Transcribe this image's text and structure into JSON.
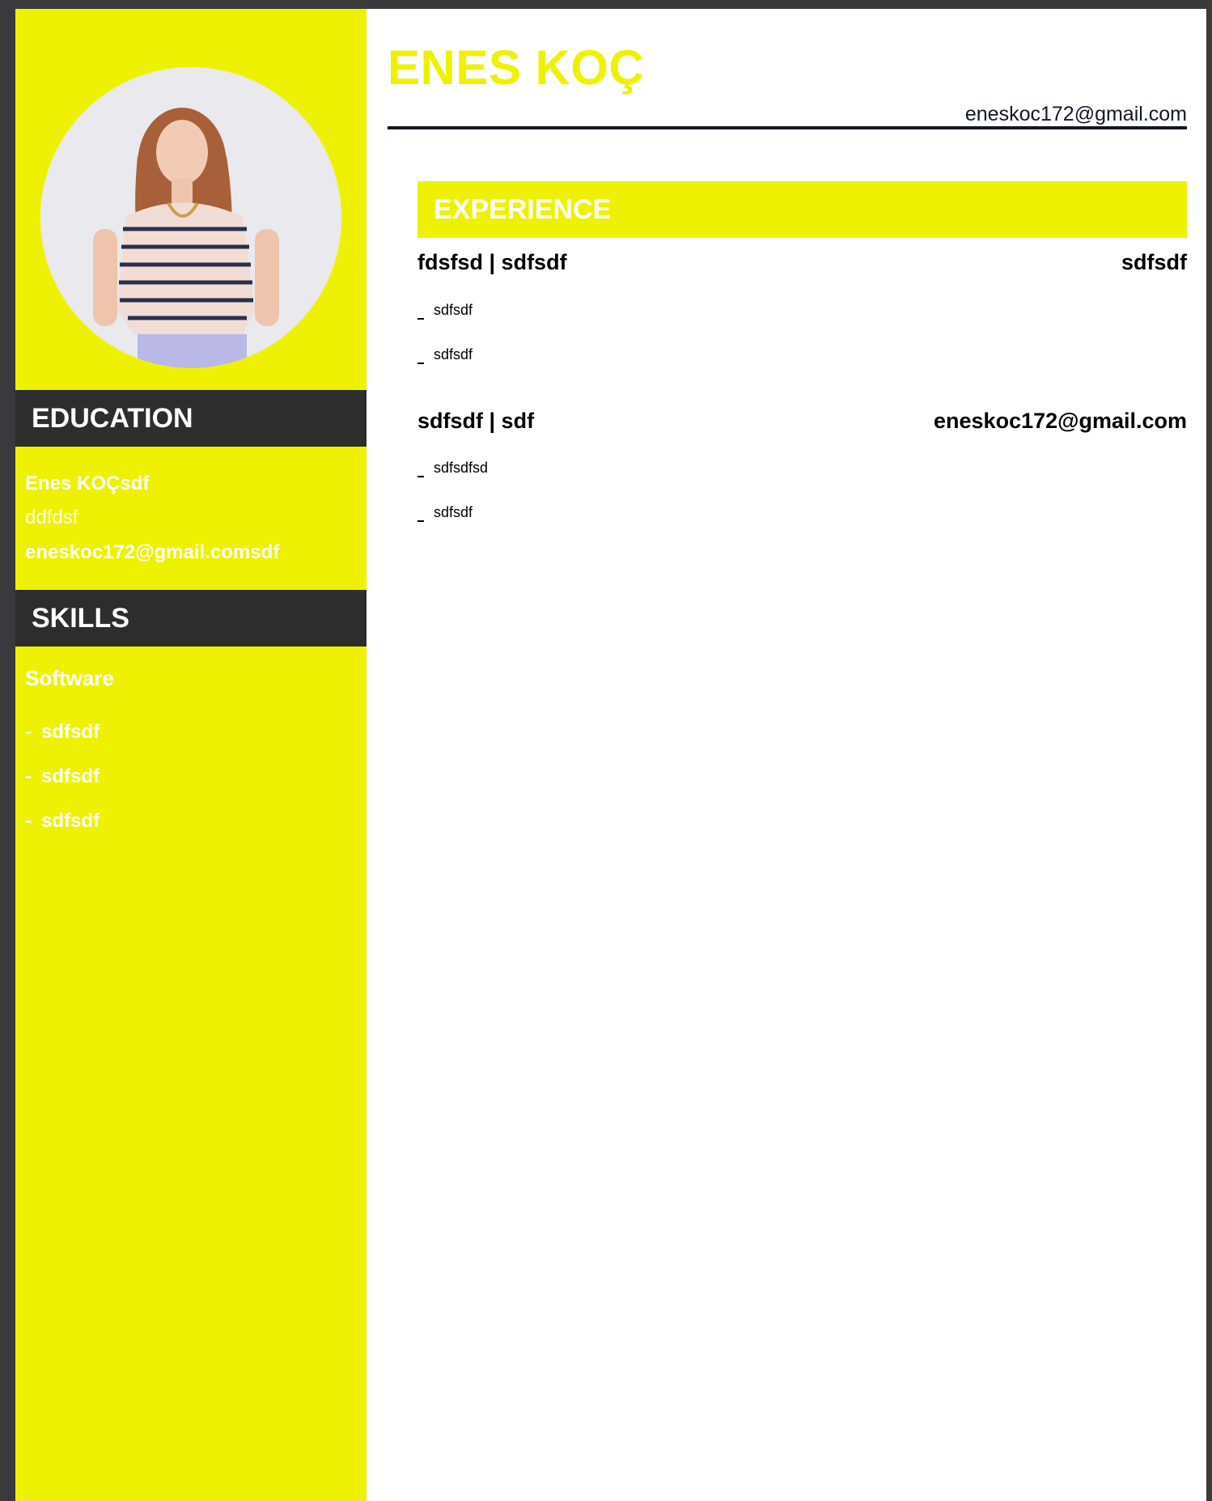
{
  "header": {
    "name": "ENES KOÇ",
    "email": "eneskoc172@gmail.com"
  },
  "sidebar": {
    "education": {
      "title": "EDUCATION",
      "school": "Enes KOÇsdf",
      "degree": "ddfdsf",
      "detail": "eneskoc172@gmail.comsdf"
    },
    "skills": {
      "title": "SKILLS",
      "category": "Software",
      "items": [
        "sdfsdf",
        "sdfsdf",
        "sdfsdf"
      ]
    }
  },
  "experience": {
    "title": "EXPERIENCE",
    "jobs": [
      {
        "title": "fdsfsd | sdfsdf",
        "right": "sdfsdf",
        "bullets": [
          "sdfsdf",
          "sdfsdf"
        ]
      },
      {
        "title": "sdfsdf | sdf",
        "right": "eneskoc172@gmail.com",
        "bullets": [
          "sdfsdfsd",
          "sdfsdf"
        ]
      }
    ]
  },
  "colors": {
    "accent": "#eef200",
    "dark": "#2d2d2d",
    "frame": "#3a3a3d"
  }
}
